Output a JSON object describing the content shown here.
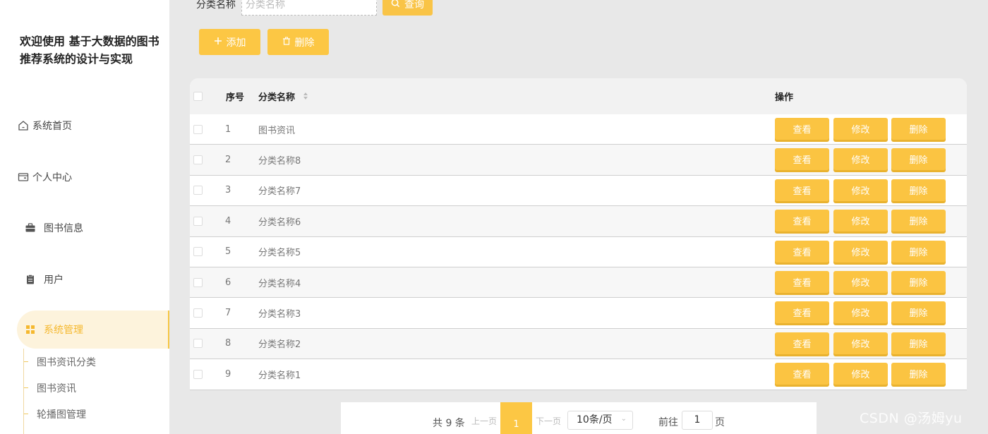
{
  "sidebar": {
    "title": "欢迎使用 基于大数据的图书推荐系统的设计与实现",
    "menu": [
      {
        "label": "系统首页",
        "icon": "home-icon"
      },
      {
        "label": "个人中心",
        "icon": "wallet-icon"
      },
      {
        "label": "图书信息",
        "icon": "briefcase-icon"
      },
      {
        "label": "用户",
        "icon": "clipboard-icon"
      },
      {
        "label": "系统管理",
        "icon": "grid-icon"
      }
    ],
    "submenu": [
      "图书资讯分类",
      "图书资讯",
      "轮播图管理"
    ]
  },
  "search": {
    "label": "分类名称",
    "placeholder": "分类名称",
    "button_label": "查询"
  },
  "actions": {
    "add_label": "添加",
    "delete_label": "删除"
  },
  "table": {
    "headers": {
      "index": "序号",
      "name": "分类名称",
      "ops": "操作"
    },
    "rows": [
      {
        "index": "1",
        "name": "图书资讯"
      },
      {
        "index": "2",
        "name": "分类名称8"
      },
      {
        "index": "3",
        "name": "分类名称7"
      },
      {
        "index": "4",
        "name": "分类名称6"
      },
      {
        "index": "5",
        "name": "分类名称5"
      },
      {
        "index": "6",
        "name": "分类名称4"
      },
      {
        "index": "7",
        "name": "分类名称3"
      },
      {
        "index": "8",
        "name": "分类名称2"
      },
      {
        "index": "9",
        "name": "分类名称1"
      }
    ],
    "row_buttons": {
      "view": "查看",
      "edit": "修改",
      "delete": "删除"
    }
  },
  "pagination": {
    "total": "共 9 条",
    "prev": "上一页",
    "current": "1",
    "next": "下一页",
    "page_size": "10条/页",
    "goto_label": "前往",
    "goto_value": "1",
    "unit": "页"
  },
  "watermark": "CSDN @汤姆yu",
  "colors": {
    "accent": "#fcc744",
    "active_bg": "#fdf3dc",
    "active_text": "#f5b82e"
  }
}
